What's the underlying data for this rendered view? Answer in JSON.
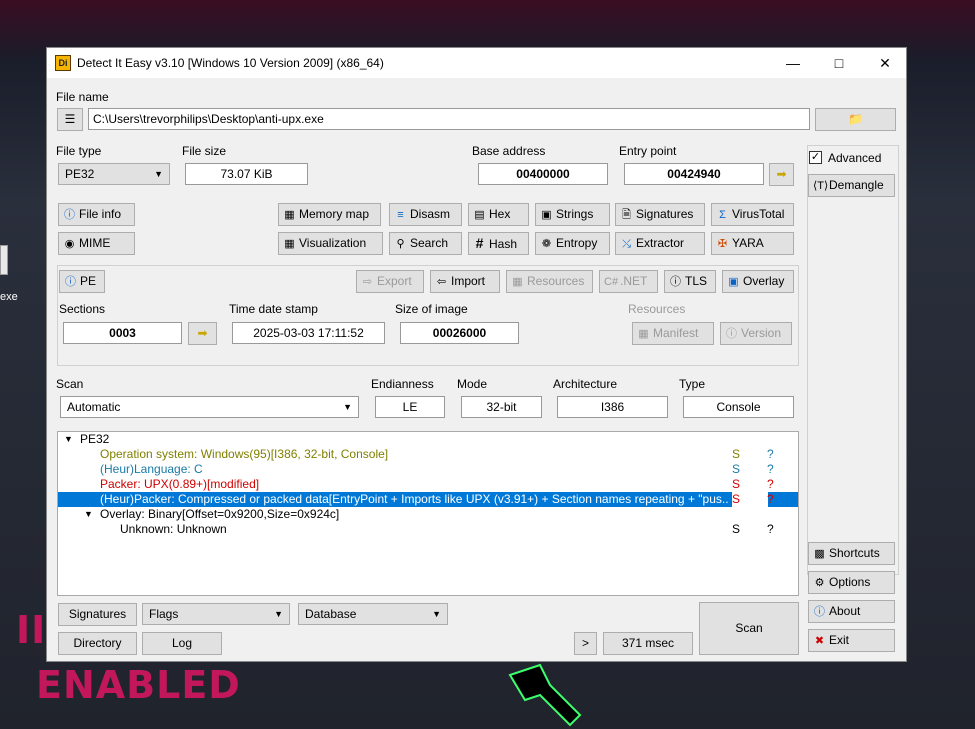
{
  "desktop": {
    "icon_label": "exe",
    "wall_text_top": "II",
    "wall_text_bottom": "ENABLED"
  },
  "window": {
    "title": "Detect It Easy v3.10 [Windows 10 Version 2009] (x86_64)",
    "icon_text": "Di"
  },
  "file": {
    "label": "File name",
    "path": "C:\\Users\\trevorphilips\\Desktop\\anti-upx.exe"
  },
  "info": {
    "file_type_label": "File type",
    "file_type": "PE32",
    "file_size_label": "File size",
    "file_size": "73.07 KiB",
    "base_address_label": "Base address",
    "base_address": "00400000",
    "entry_point_label": "Entry point",
    "entry_point": "00424940"
  },
  "tools": {
    "file_info": "File info",
    "memory_map": "Memory map",
    "disasm": "Disasm",
    "hex": "Hex",
    "strings": "Strings",
    "signatures": "Signatures",
    "virustotal": "VirusTotal",
    "mime": "MIME",
    "visualization": "Visualization",
    "search": "Search",
    "hash": "Hash",
    "entropy": "Entropy",
    "extractor": "Extractor",
    "yara": "YARA"
  },
  "pe": {
    "pe": "PE",
    "export": "Export",
    "import": "Import",
    "resources": "Resources",
    "net": ".NET",
    "tls": "TLS",
    "overlay": "Overlay",
    "sections_label": "Sections",
    "sections": "0003",
    "tds_label": "Time date stamp",
    "tds": "2025-03-03 17:11:52",
    "image_size_label": "Size of image",
    "image_size": "00026000",
    "resources_label": "Resources",
    "manifest": "Manifest",
    "version": "Version"
  },
  "scan": {
    "scan_label": "Scan",
    "scan_mode": "Automatic",
    "endianness_label": "Endianness",
    "endianness": "LE",
    "mode_label": "Mode",
    "mode": "32-bit",
    "arch_label": "Architecture",
    "arch": "I386",
    "type_label": "Type",
    "type": "Console"
  },
  "results": {
    "root": "PE32",
    "rows": [
      {
        "text": "Operation system: Windows(95)[I386, 32-bit, Console]",
        "s": "S",
        "q": "?",
        "color": "#808000"
      },
      {
        "text": "(Heur)Language: C",
        "s": "S",
        "q": "?",
        "color": "#1a7aa8"
      },
      {
        "text": "Packer: UPX(0.89+)[modified]",
        "s": "S",
        "q": "?",
        "color": "#d00000"
      },
      {
        "text": "(Heur)Packer: Compressed or packed data[EntryPoint + Imports like UPX (v3.91+) + Section names repeating + \"pus...",
        "s": "S",
        "q": "?",
        "color": "#ffffff"
      },
      {
        "text": "Overlay: Binary[Offset=0x9200,Size=0x924c]",
        "s": "",
        "q": "",
        "color": "#000000"
      },
      {
        "text": "Unknown: Unknown",
        "s": "S",
        "q": "?",
        "color": "#000000"
      }
    ]
  },
  "side": {
    "advanced": "Advanced",
    "demangle": "Demangle",
    "shortcuts": "Shortcuts",
    "options": "Options",
    "about": "About",
    "exit": "Exit"
  },
  "bottom": {
    "signatures": "Signatures",
    "flags": "Flags",
    "database": "Database",
    "directory": "Directory",
    "log": "Log",
    "more": ">",
    "time": "371 msec",
    "scan": "Scan"
  }
}
